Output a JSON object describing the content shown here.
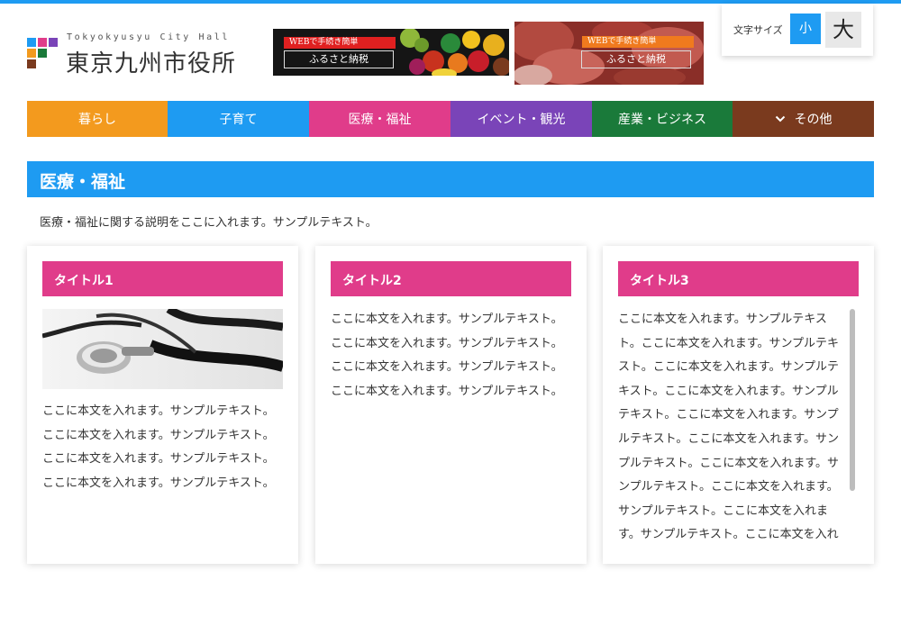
{
  "header": {
    "logo_en": "Tokyokyusyu City Hall",
    "logo_ja": "東京九州市役所",
    "logo_colors": [
      "#1e9bf2",
      "#e03c8a",
      "#7a44b8",
      "#f39a1e",
      "#1a7a3a",
      "#7a3a1e"
    ],
    "banners": [
      {
        "tag": "WEBで手続き簡単",
        "label": "ふるさと納税",
        "tag_color": "#e02020"
      },
      {
        "tag": "WEBで手続き簡単",
        "label": "ふるさと納税",
        "tag_color": "#f07a1e"
      }
    ],
    "font_size": {
      "label": "文字サイズ",
      "small": "小",
      "large": "大"
    }
  },
  "nav": [
    {
      "label": "暮らし",
      "color": "#f39a1e"
    },
    {
      "label": "子育て",
      "color": "#1e9bf2"
    },
    {
      "label": "医療・福祉",
      "color": "#e03c8a"
    },
    {
      "label": "イベント・観光",
      "color": "#7a44b8"
    },
    {
      "label": "産業・ビジネス",
      "color": "#1a7a3a"
    },
    {
      "label": "その他",
      "color": "#7a3a1e",
      "icon": "chevron-down-icon"
    }
  ],
  "section": {
    "title": "医療・福祉",
    "description": "医療・福祉に関する説明をここに入れます。サンプルテキスト。"
  },
  "cards": [
    {
      "title": "タイトル1",
      "image": "stethoscope-image",
      "lines": [
        "ここに本文を入れます。サンプルテキスト。",
        "ここに本文を入れます。サンプルテキスト。",
        "ここに本文を入れます。サンプルテキスト。",
        "ここに本文を入れます。サンプルテキスト。"
      ]
    },
    {
      "title": "タイトル2",
      "lines": [
        "ここに本文を入れます。サンプルテキスト。",
        "ここに本文を入れます。サンプルテキスト。",
        "ここに本文を入れます。サンプルテキスト。",
        "ここに本文を入れます。サンプルテキスト。"
      ]
    },
    {
      "title": "タイトル3",
      "lines": [
        "ここに本文を入れます。サンプルテキス",
        "ト。ここに本文を入れます。サンプルテキ",
        "スト。ここに本文を入れます。サンプルテ",
        "キスト。ここに本文を入れます。サンプル",
        "テキスト。ここに本文を入れます。サンプ",
        "ルテキスト。ここに本文を入れます。サン",
        "プルテキスト。ここに本文を入れます。サ",
        "ンプルテキスト。ここに本文を入れます。",
        "サンプルテキスト。ここに本文を入れま",
        "す。サンプルテキスト。ここに本文を入れ"
      ]
    }
  ]
}
